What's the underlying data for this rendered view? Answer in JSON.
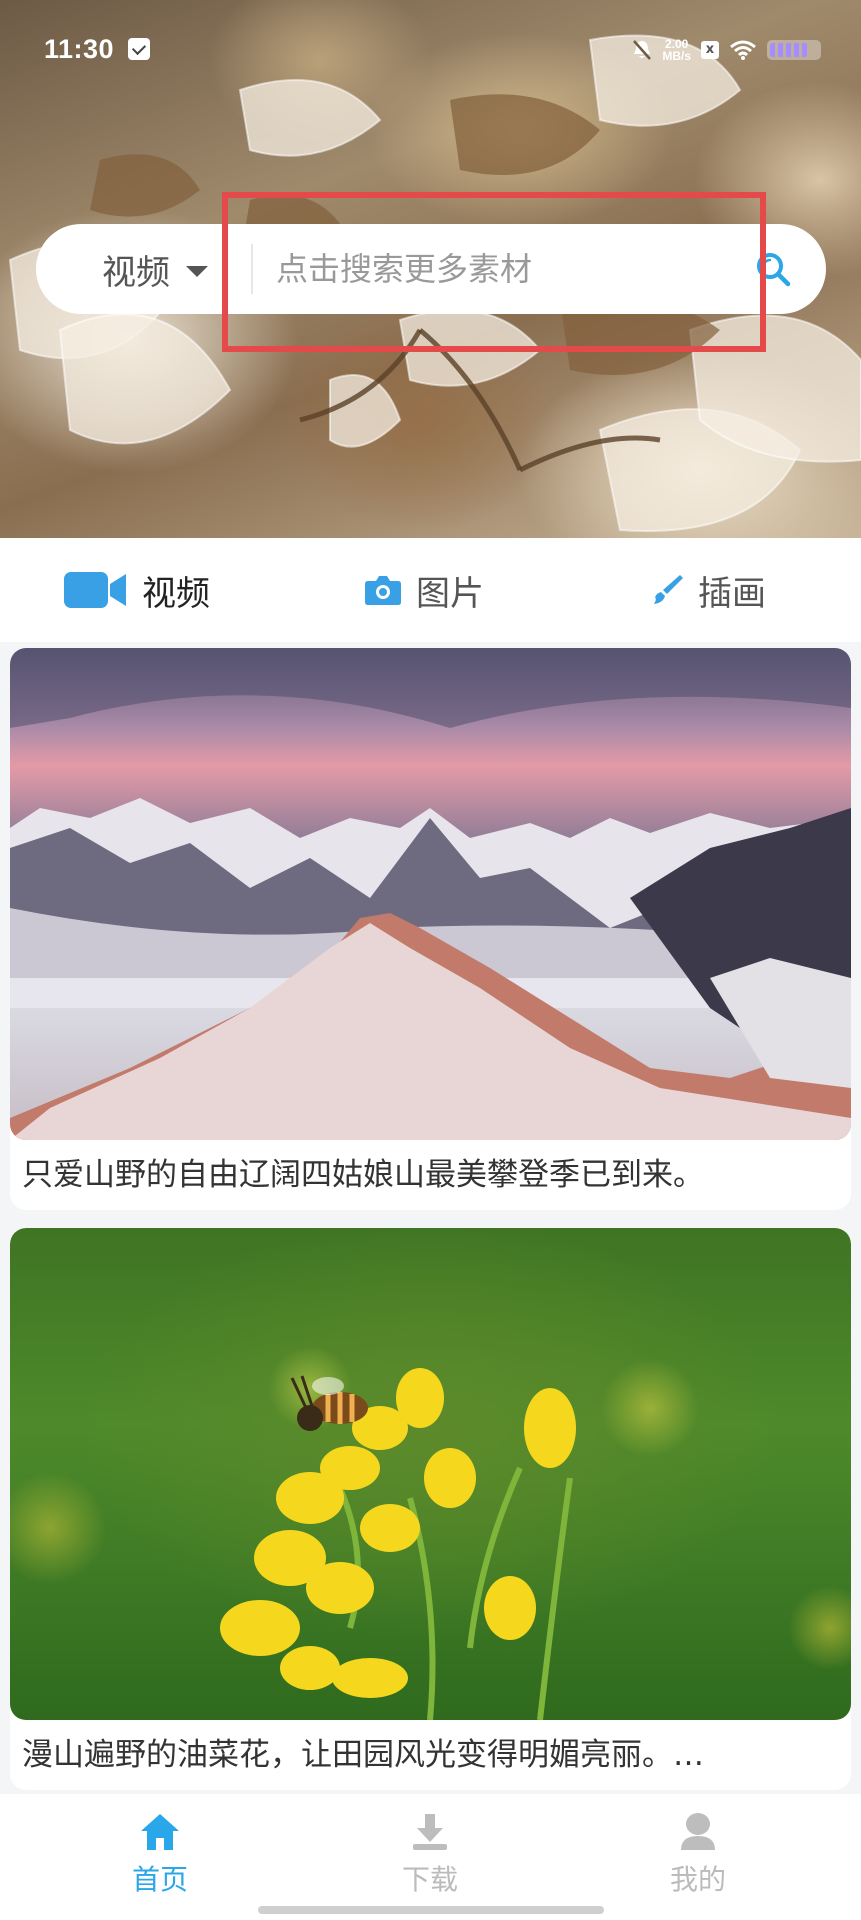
{
  "status_bar": {
    "time": "11:30",
    "net_speed_value": "2.00",
    "net_speed_unit": "MB/s",
    "xbox_label": "x"
  },
  "search": {
    "type_label": "视频",
    "placeholder": "点击搜索更多素材",
    "value": ""
  },
  "tabs": [
    {
      "label": "视频",
      "icon": "video-camera-icon",
      "active": true
    },
    {
      "label": "图片",
      "icon": "camera-icon",
      "active": false
    },
    {
      "label": "插画",
      "icon": "paintbrush-icon",
      "active": false
    }
  ],
  "cards": [
    {
      "caption": "只爱山野的自由辽阔四姑娘山最美攀登季已到来。",
      "image": "snowy-mountain-sunset"
    },
    {
      "caption": "漫山遍野的油菜花，让田园风光变得明媚亮丽。…",
      "image": "bee-on-rapeseed-flower"
    }
  ],
  "bottom_nav": [
    {
      "label": "首页",
      "icon": "home-icon",
      "active": true
    },
    {
      "label": "下载",
      "icon": "download-icon",
      "active": false
    },
    {
      "label": "我的",
      "icon": "person-icon",
      "active": false
    }
  ],
  "colors": {
    "accent": "#29a7e8",
    "highlight": "#e54a4a",
    "text": "#333333",
    "muted": "#bbbbbb"
  }
}
